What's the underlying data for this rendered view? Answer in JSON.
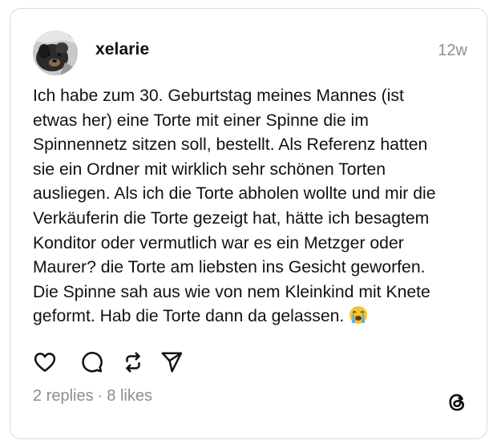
{
  "post": {
    "author": {
      "username": "xelarie",
      "avatar_icon": "dog-photo-avatar"
    },
    "timestamp": "12w",
    "text": "Ich habe zum 30. Geburtstag meines Mannes (ist\netwas her) eine Torte mit einer Spinne die im\nSpinnennetz sitzen soll, bestellt. Als Referenz hatten\nsie ein Ordner mit wirklich sehr schönen Torten\nausliegen. Als ich die Torte abholen wollte und mir die\nVerkäuferin die Torte gezeigt hat, hätte ich besagtem\nKonditor oder vermutlich war es ein Metzger oder\nMaurer? die Torte am liebsten ins Gesicht geworfen.\nDie Spinne sah aus wie von nem Kleinkind mit Knete\ngeformt. Hab die Torte dann da gelassen.",
    "emoji_icon": "loudly-crying-face-emoji",
    "actions": [
      "heart-icon",
      "comment-icon",
      "repost-icon",
      "share-icon"
    ],
    "replies": "2 replies",
    "separator": "·",
    "likes": "8 likes",
    "platform_icon": "threads-logo-icon"
  },
  "colors": {
    "text": "#111111",
    "muted": "#8e8e8e",
    "border": "#d9d9d9",
    "emoji_face": "#f4c430",
    "tears": "#5dade2"
  }
}
